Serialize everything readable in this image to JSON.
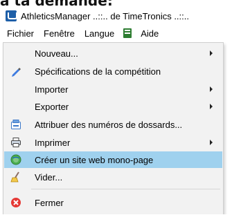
{
  "header_fragment": "à ta demande:",
  "window": {
    "title": "AthleticsManager ..::.. de TimeTronics ..::.."
  },
  "menubar": {
    "fichier": "Fichier",
    "fenetre": "Fenêtre",
    "langue": "Langue",
    "aide": "Aide"
  },
  "menu": {
    "nouveau": "Nouveau...",
    "specifications": "Spécifications de la compétition",
    "importer": "Importer",
    "exporter": "Exporter",
    "attribuer": "Attribuer des numéros de dossards...",
    "imprimer": "Imprimer",
    "creer_site": "Créer un site web mono-page",
    "vider": "Vider...",
    "fermer": "Fermer"
  },
  "colors": {
    "highlight": "#9fd1ee",
    "menu_bg": "#f2f2f2",
    "close_red": "#e53935"
  }
}
